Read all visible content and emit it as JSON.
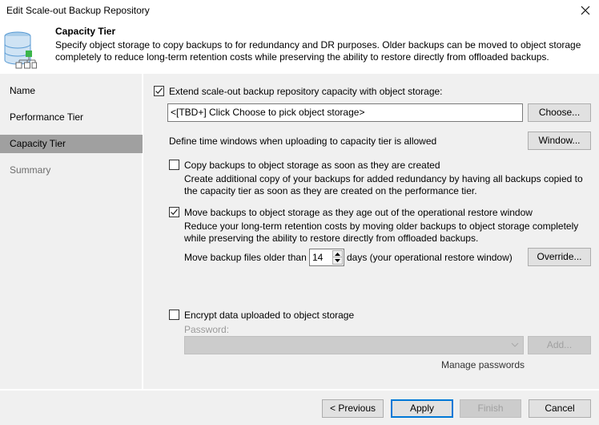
{
  "window": {
    "title": "Edit Scale-out Backup Repository",
    "close_icon": "close-icon"
  },
  "header": {
    "icon": "scale-out-repository-icon",
    "title": "Capacity Tier",
    "description": "Specify object storage to copy backups to for redundancy and DR purposes. Older backups can be moved to object storage completely to reduce long-term retention costs while preserving the ability to restore directly from offloaded backups."
  },
  "sidebar": {
    "items": [
      {
        "label": "Name",
        "state": "normal"
      },
      {
        "label": "Performance Tier",
        "state": "normal"
      },
      {
        "label": "Capacity Tier",
        "state": "active"
      },
      {
        "label": "Summary",
        "state": "disabled"
      }
    ]
  },
  "main": {
    "extend": {
      "checked": true,
      "label": "Extend scale-out backup repository capacity with object storage:",
      "storage_value": "<[TBD+] Click Choose to pick object storage>",
      "choose_label": "Choose..."
    },
    "window_row": {
      "label": "Define time windows when uploading to capacity tier is allowed",
      "button_label": "Window..."
    },
    "copy": {
      "checked": false,
      "label": "Copy backups to object storage as soon as they are created",
      "description": "Create additional copy of your backups for added redundancy by having all backups copied to the capacity tier as soon as they are created on the performance tier."
    },
    "move": {
      "checked": true,
      "label": "Move backups to object storage as they age out of the operational restore window",
      "description": "Reduce your long-term retention costs by moving older backups to object storage completely while preserving the ability to restore directly from offloaded backups.",
      "older_than_prefix": "Move backup files older than",
      "days_value": "14",
      "older_than_suffix": "days (your operational restore window)",
      "override_label": "Override..."
    },
    "encrypt": {
      "checked": false,
      "label": "Encrypt data uploaded to object storage",
      "password_label": "Password:",
      "password_value": "",
      "add_label": "Add...",
      "manage_label": "Manage passwords"
    }
  },
  "footer": {
    "previous_label": "< Previous",
    "apply_label": "Apply",
    "finish_label": "Finish",
    "cancel_label": "Cancel"
  },
  "colors": {
    "accent": "#0078d7",
    "sidebar_active": "#a0a0a0",
    "icon_green": "#3bb54a",
    "icon_blue": "#a9cdea"
  }
}
